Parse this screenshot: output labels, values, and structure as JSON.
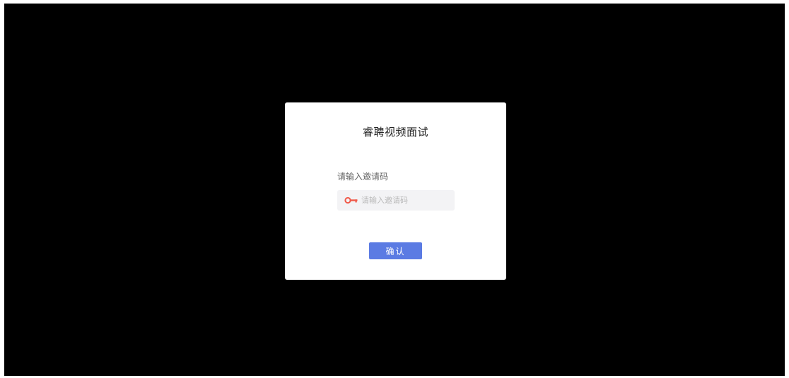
{
  "modal": {
    "title": "睿聘视频面试",
    "field_label": "请输入邀请码",
    "input": {
      "value": "",
      "placeholder": "请输入邀请码",
      "icon": "key-icon"
    },
    "confirm_label": "确认"
  },
  "colors": {
    "overlay": "#000000",
    "modal_bg": "#ffffff",
    "accent": "#5b7be3",
    "key_icon": "#f05a4a",
    "input_bg": "#f3f3f5"
  }
}
